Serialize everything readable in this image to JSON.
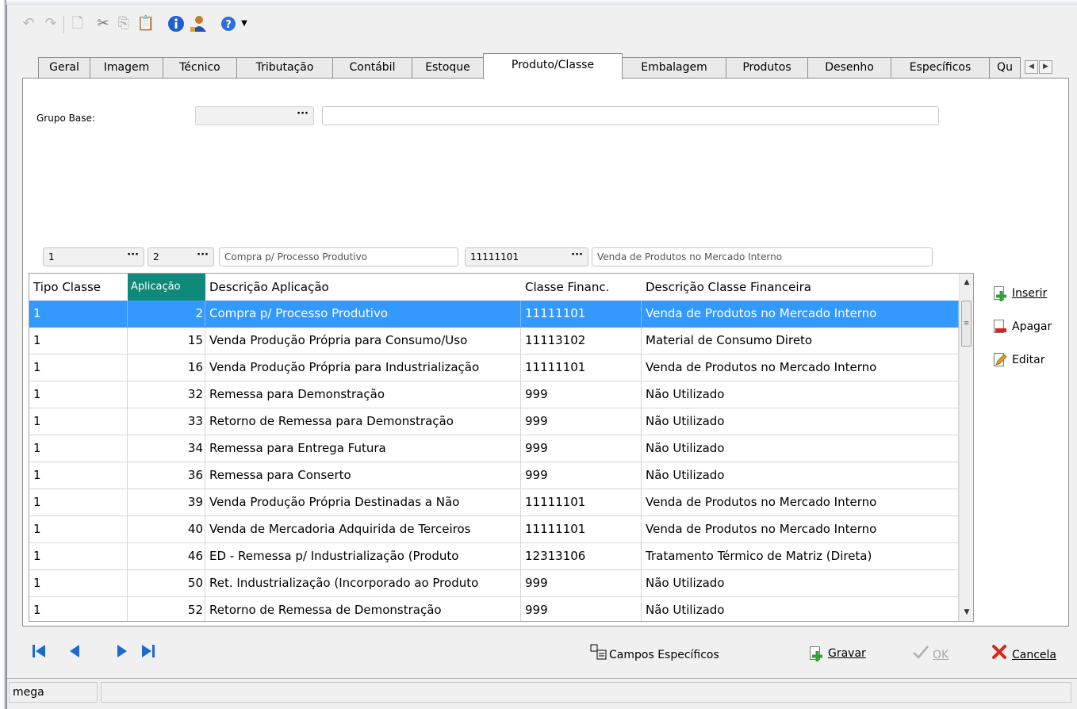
{
  "toolbar": {
    "icons": [
      "undo-icon",
      "redo-icon",
      "new-icon",
      "cut-icon",
      "copy-icon",
      "paste-icon",
      "info-icon",
      "user-icon",
      "help-icon",
      "dropdown-arrow-icon"
    ]
  },
  "tabs": [
    "Geral",
    "Imagem",
    "Técnico",
    "Tributação",
    "Contábil",
    "Estoque",
    "Produto/Classe",
    "Embalagem",
    "Produtos",
    "Desenho",
    "Específicos",
    "Qu"
  ],
  "active_tab": "Produto/Classe",
  "form": {
    "grupo_base_label": "Grupo Base:",
    "grupo_base_code": "",
    "grupo_base_desc": ""
  },
  "filters": {
    "tipo_classe": "1",
    "aplicacao": "2",
    "aplicacao_desc": "Compra p/ Processo Produtivo",
    "classe_financ": "11111101",
    "classe_desc": "Venda de Produtos no Mercado Interno"
  },
  "grid": {
    "columns": [
      "Tipo Classe",
      "Aplicação",
      "Descrição Aplicação",
      "Classe Financ.",
      "Descrição Classe Financeira"
    ],
    "sorted_column": "Aplicação",
    "rows": [
      [
        "1",
        "2",
        "Compra p/ Processo Produtivo",
        "11111101",
        "Venda de Produtos no Mercado Interno"
      ],
      [
        "1",
        "15",
        "Venda Produção Própria para Consumo/Uso",
        "11113102",
        "Material de Consumo Direto"
      ],
      [
        "1",
        "16",
        "Venda Produção Própria para Industrialização",
        "11111101",
        "Venda de Produtos no Mercado Interno"
      ],
      [
        "1",
        "32",
        "Remessa para Demonstração",
        "999",
        "Não Utilizado"
      ],
      [
        "1",
        "33",
        "Retorno de Remessa para Demonstração",
        "999",
        "Não Utilizado"
      ],
      [
        "1",
        "34",
        "Remessa para Entrega Futura",
        "999",
        "Não Utilizado"
      ],
      [
        "1",
        "36",
        "Remessa para Conserto",
        "999",
        "Não Utilizado"
      ],
      [
        "1",
        "39",
        "Venda Produção Própria Destinadas a Não",
        "11111101",
        "Venda de Produtos no Mercado Interno"
      ],
      [
        "1",
        "40",
        "Venda de Mercadoria Adquirida de Terceiros",
        "11111101",
        "Venda de Produtos no Mercado Interno"
      ],
      [
        "1",
        "46",
        "ED -  Remessa p/ Industrialização (Produto",
        "12313106",
        "Tratamento Térmico de Matriz  (Direta)"
      ],
      [
        "1",
        "50",
        "Ret. Industrialização (Incorporado ao Produto",
        "999",
        "Não Utilizado"
      ],
      [
        "1",
        "52",
        "Retorno de Remessa de Demonstração",
        "999",
        "Não Utilizado"
      ]
    ],
    "selected_row": 0
  },
  "side_buttons": {
    "inserir": "Inserir",
    "apagar": "Apagar",
    "editar": "Editar"
  },
  "bottom": {
    "campos": "Campos Específicos",
    "gravar": "Gravar",
    "ok": "OK",
    "cancela": "Cancela"
  },
  "status": {
    "user": "mega"
  },
  "colors": {
    "selection": "#3399ff",
    "sorted_header": "#0f8a7a",
    "nav_blue": "#1f6ad1",
    "cancel_red": "#d9261c"
  }
}
